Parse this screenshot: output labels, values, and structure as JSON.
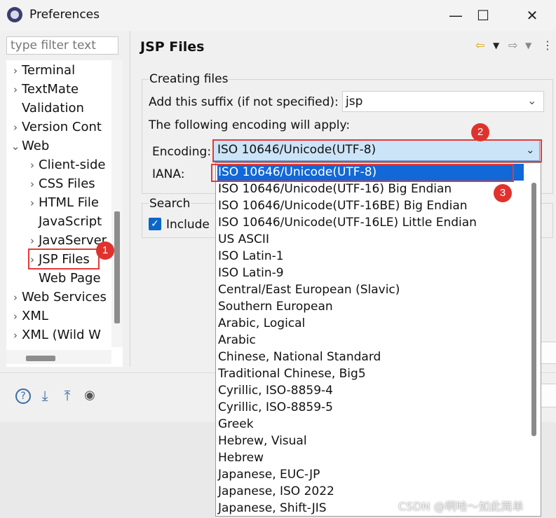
{
  "window": {
    "title": "Preferences",
    "controls": {
      "minimize": "—",
      "maximize": "☐",
      "close": "✕"
    }
  },
  "filter": {
    "placeholder": "type filter text"
  },
  "tree": {
    "items": [
      {
        "label": "Terminal",
        "expander": "›"
      },
      {
        "label": "TextMate",
        "expander": "›"
      },
      {
        "label": "Validation",
        "expander": ""
      },
      {
        "label": "Version Cont",
        "expander": "›"
      },
      {
        "label": "Web",
        "expander": "⌄"
      },
      {
        "label": "Client-side",
        "expander": "›"
      },
      {
        "label": "CSS Files",
        "expander": "›"
      },
      {
        "label": "HTML File",
        "expander": "›"
      },
      {
        "label": "JavaScript",
        "expander": ""
      },
      {
        "label": "JavaServer",
        "expander": "›"
      },
      {
        "label": "JSP Files",
        "expander": "›"
      },
      {
        "label": "Web Page",
        "expander": ""
      },
      {
        "label": "Web Services",
        "expander": "›"
      },
      {
        "label": "XML",
        "expander": "›"
      },
      {
        "label": "XML (Wild W",
        "expander": "›"
      }
    ]
  },
  "page": {
    "title": "JSP Files",
    "creating_group": "Creating files",
    "suffix_label": "Add this suffix (if not specified):",
    "suffix_value": "jsp",
    "encoding_apply_label": "The following encoding will apply:",
    "encoding_label": "Encoding:",
    "encoding_value": "ISO 10646/Unicode(UTF-8)",
    "iana_label": "IANA:",
    "search_group": "Search",
    "include_label": "Include"
  },
  "encoding_options": [
    "ISO 10646/Unicode(UTF-8)",
    "ISO 10646/Unicode(UTF-16) Big Endian",
    "ISO 10646/Unicode(UTF-16BE) Big Endian",
    "ISO 10646/Unicode(UTF-16LE) Little Endian",
    "US ASCII",
    "ISO Latin-1",
    "ISO Latin-9",
    "Central/East European (Slavic)",
    "Southern European",
    "Arabic, Logical",
    "Arabic",
    "Chinese, National Standard",
    "Traditional Chinese, Big5",
    "Cyrillic, ISO-8859-4",
    "Cyrillic, ISO-8859-5",
    "Greek",
    "Hebrew, Visual",
    "Hebrew",
    "Japanese, EUC-JP",
    "Japanese, ISO 2022",
    "Japanese, Shift-JIS"
  ],
  "badges": {
    "b1": "1",
    "b2": "2",
    "b3": "3"
  },
  "icons": {
    "help": "help-icon",
    "import": "import-icon",
    "export": "export-icon",
    "oomph": "record-icon"
  },
  "colors": {
    "selection": "#1168d6",
    "annotation": "#e0322d",
    "combo_highlight": "#cce4f7"
  },
  "watermark": "CSDN @啊哈～如此简单"
}
